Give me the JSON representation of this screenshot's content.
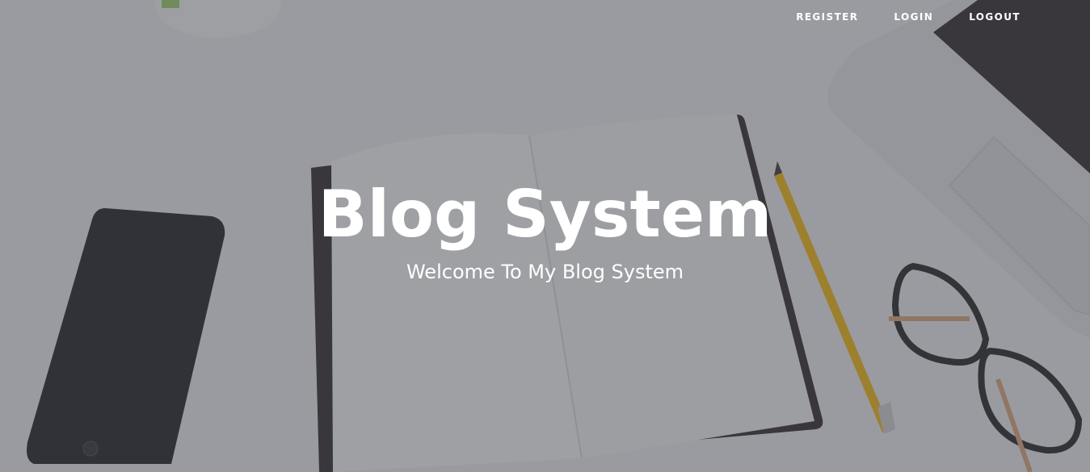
{
  "nav": {
    "items": [
      {
        "label": "REGISTER"
      },
      {
        "label": "LOGIN"
      },
      {
        "label": "LOGOUT"
      }
    ]
  },
  "header": {
    "title": "Blog System",
    "subtitle": "Welcome To My Blog System"
  },
  "background": {
    "description_icons": [
      "notebook-icon",
      "phone-icon",
      "pencil-icon",
      "glasses-icon",
      "laptop-icon",
      "cup-icon"
    ],
    "overlay_color": "#484a52"
  }
}
